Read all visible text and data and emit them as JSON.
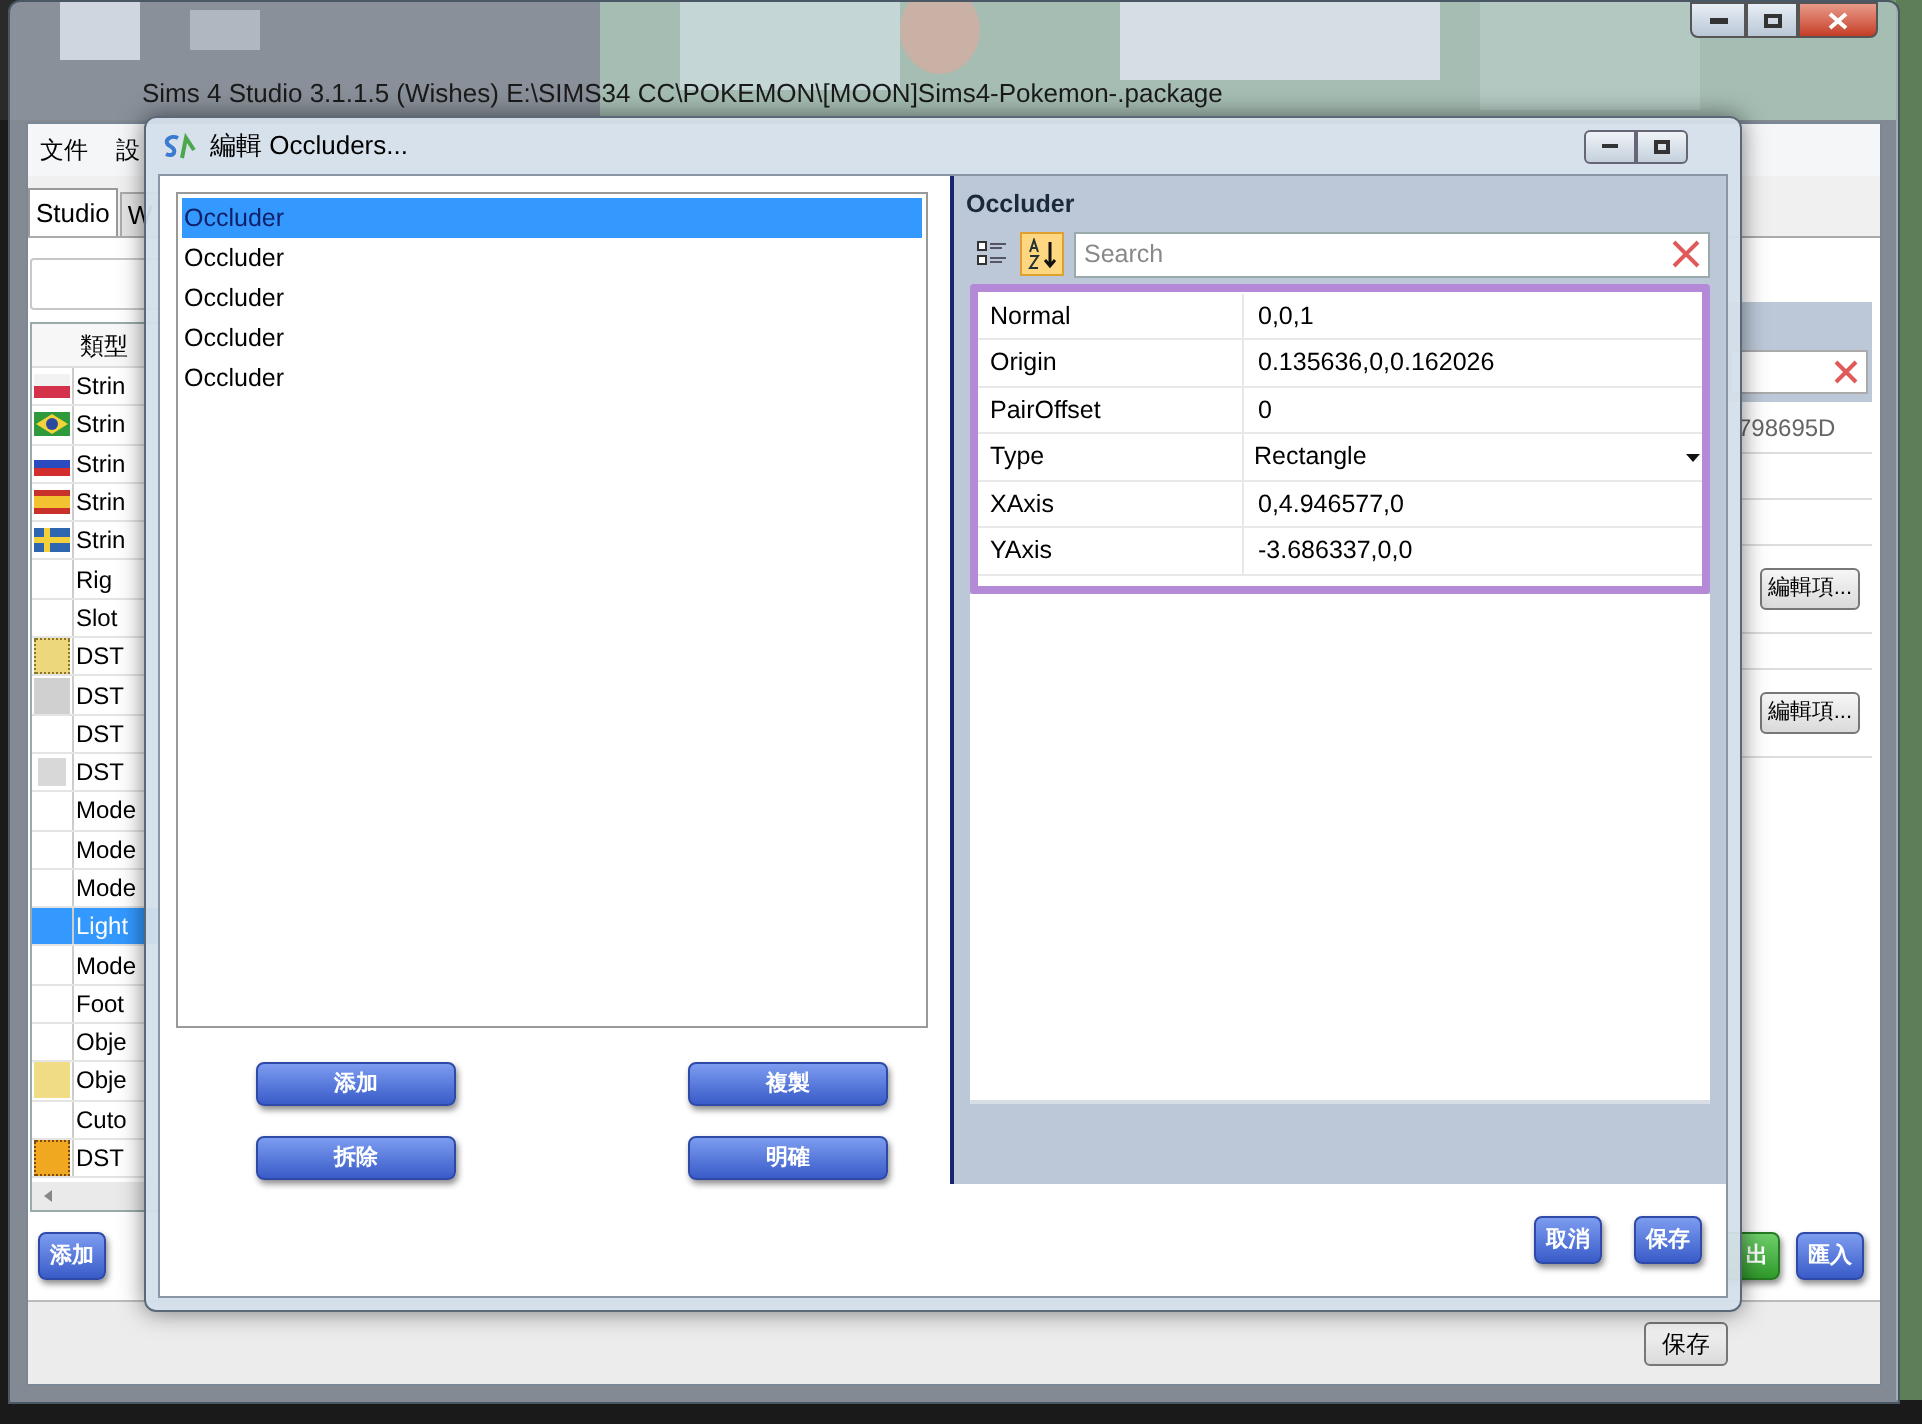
{
  "main_window": {
    "title": "Sims 4 Studio 3.1.1.5 (Wishes)  E:\\SIMS34 CC\\POKEMON\\[MOON]Sims4-Pokemon-.package",
    "menu": [
      "文件",
      "設"
    ],
    "tabs": [
      {
        "label": "Studio",
        "selected": true
      },
      {
        "label": "W",
        "selected": false
      }
    ],
    "table": {
      "column_header": "類型",
      "rows": [
        {
          "type": "Strin",
          "kind": "flag_pl",
          "selected": false
        },
        {
          "type": "Strin",
          "kind": "flag_br",
          "selected": false
        },
        {
          "type": "Strin",
          "kind": "flag_ru",
          "selected": false
        },
        {
          "type": "Strin",
          "kind": "flag_es",
          "selected": false
        },
        {
          "type": "Strin",
          "kind": "flag_se",
          "selected": false
        },
        {
          "type": "Rig",
          "kind": "plain",
          "selected": false
        },
        {
          "type": "Slot",
          "kind": "plain",
          "selected": false
        },
        {
          "type": "DST",
          "kind": "thumb_yellow",
          "selected": false
        },
        {
          "type": "DST",
          "kind": "thumb_gray",
          "selected": false
        },
        {
          "type": "DST",
          "kind": "plain",
          "selected": false
        },
        {
          "type": "DST",
          "kind": "thumb_light",
          "selected": false
        },
        {
          "type": "Mode",
          "kind": "plain",
          "selected": false
        },
        {
          "type": "Mode",
          "kind": "plain",
          "selected": false
        },
        {
          "type": "Mode",
          "kind": "plain",
          "selected": false
        },
        {
          "type": "Light",
          "kind": "plain",
          "selected": true
        },
        {
          "type": "Mode",
          "kind": "plain",
          "selected": false
        },
        {
          "type": "Foot",
          "kind": "plain",
          "selected": false
        },
        {
          "type": "Obje",
          "kind": "plain",
          "selected": false
        },
        {
          "type": "Obje",
          "kind": "thumb_sand",
          "selected": false
        },
        {
          "type": "Cuto",
          "kind": "plain",
          "selected": false
        },
        {
          "type": "DST",
          "kind": "thumb_orange",
          "selected": false
        }
      ]
    },
    "side_value": "798695D",
    "edit_buttons": [
      "編輯項...",
      "編輯項..."
    ],
    "bottom_buttons": [
      {
        "label": "添加",
        "kind": "blue"
      },
      {
        "label": "出",
        "kind": "green"
      },
      {
        "label": "匯入",
        "kind": "blue"
      }
    ],
    "status_button": "保存"
  },
  "dialog": {
    "title": "編輯 Occluders...",
    "items": [
      {
        "label": "Occluder",
        "selected": true
      },
      {
        "label": "Occluder",
        "selected": false
      },
      {
        "label": "Occluder",
        "selected": false
      },
      {
        "label": "Occluder",
        "selected": false
      },
      {
        "label": "Occluder",
        "selected": false
      }
    ],
    "list_buttons": [
      "添加",
      "複製",
      "拆除",
      "明確"
    ],
    "properties_panel": {
      "title": "Occluder",
      "categorized_selected": false,
      "alphabetical_selected": true,
      "search": {
        "placeholder": "Search"
      },
      "properties": [
        {
          "name": "Normal",
          "value": "0,0,1",
          "kind": "text"
        },
        {
          "name": "Origin",
          "value": "0.135636,0,0.162026",
          "kind": "text"
        },
        {
          "name": "PairOffset",
          "value": "0",
          "kind": "text"
        },
        {
          "name": "Type",
          "value": "Rectangle",
          "kind": "dropdown"
        },
        {
          "name": "XAxis",
          "value": "0,4.946577,0",
          "kind": "text"
        },
        {
          "name": "YAxis",
          "value": "-3.686337,0,0",
          "kind": "text"
        }
      ]
    },
    "footer_buttons": [
      "取消",
      "保存"
    ]
  }
}
